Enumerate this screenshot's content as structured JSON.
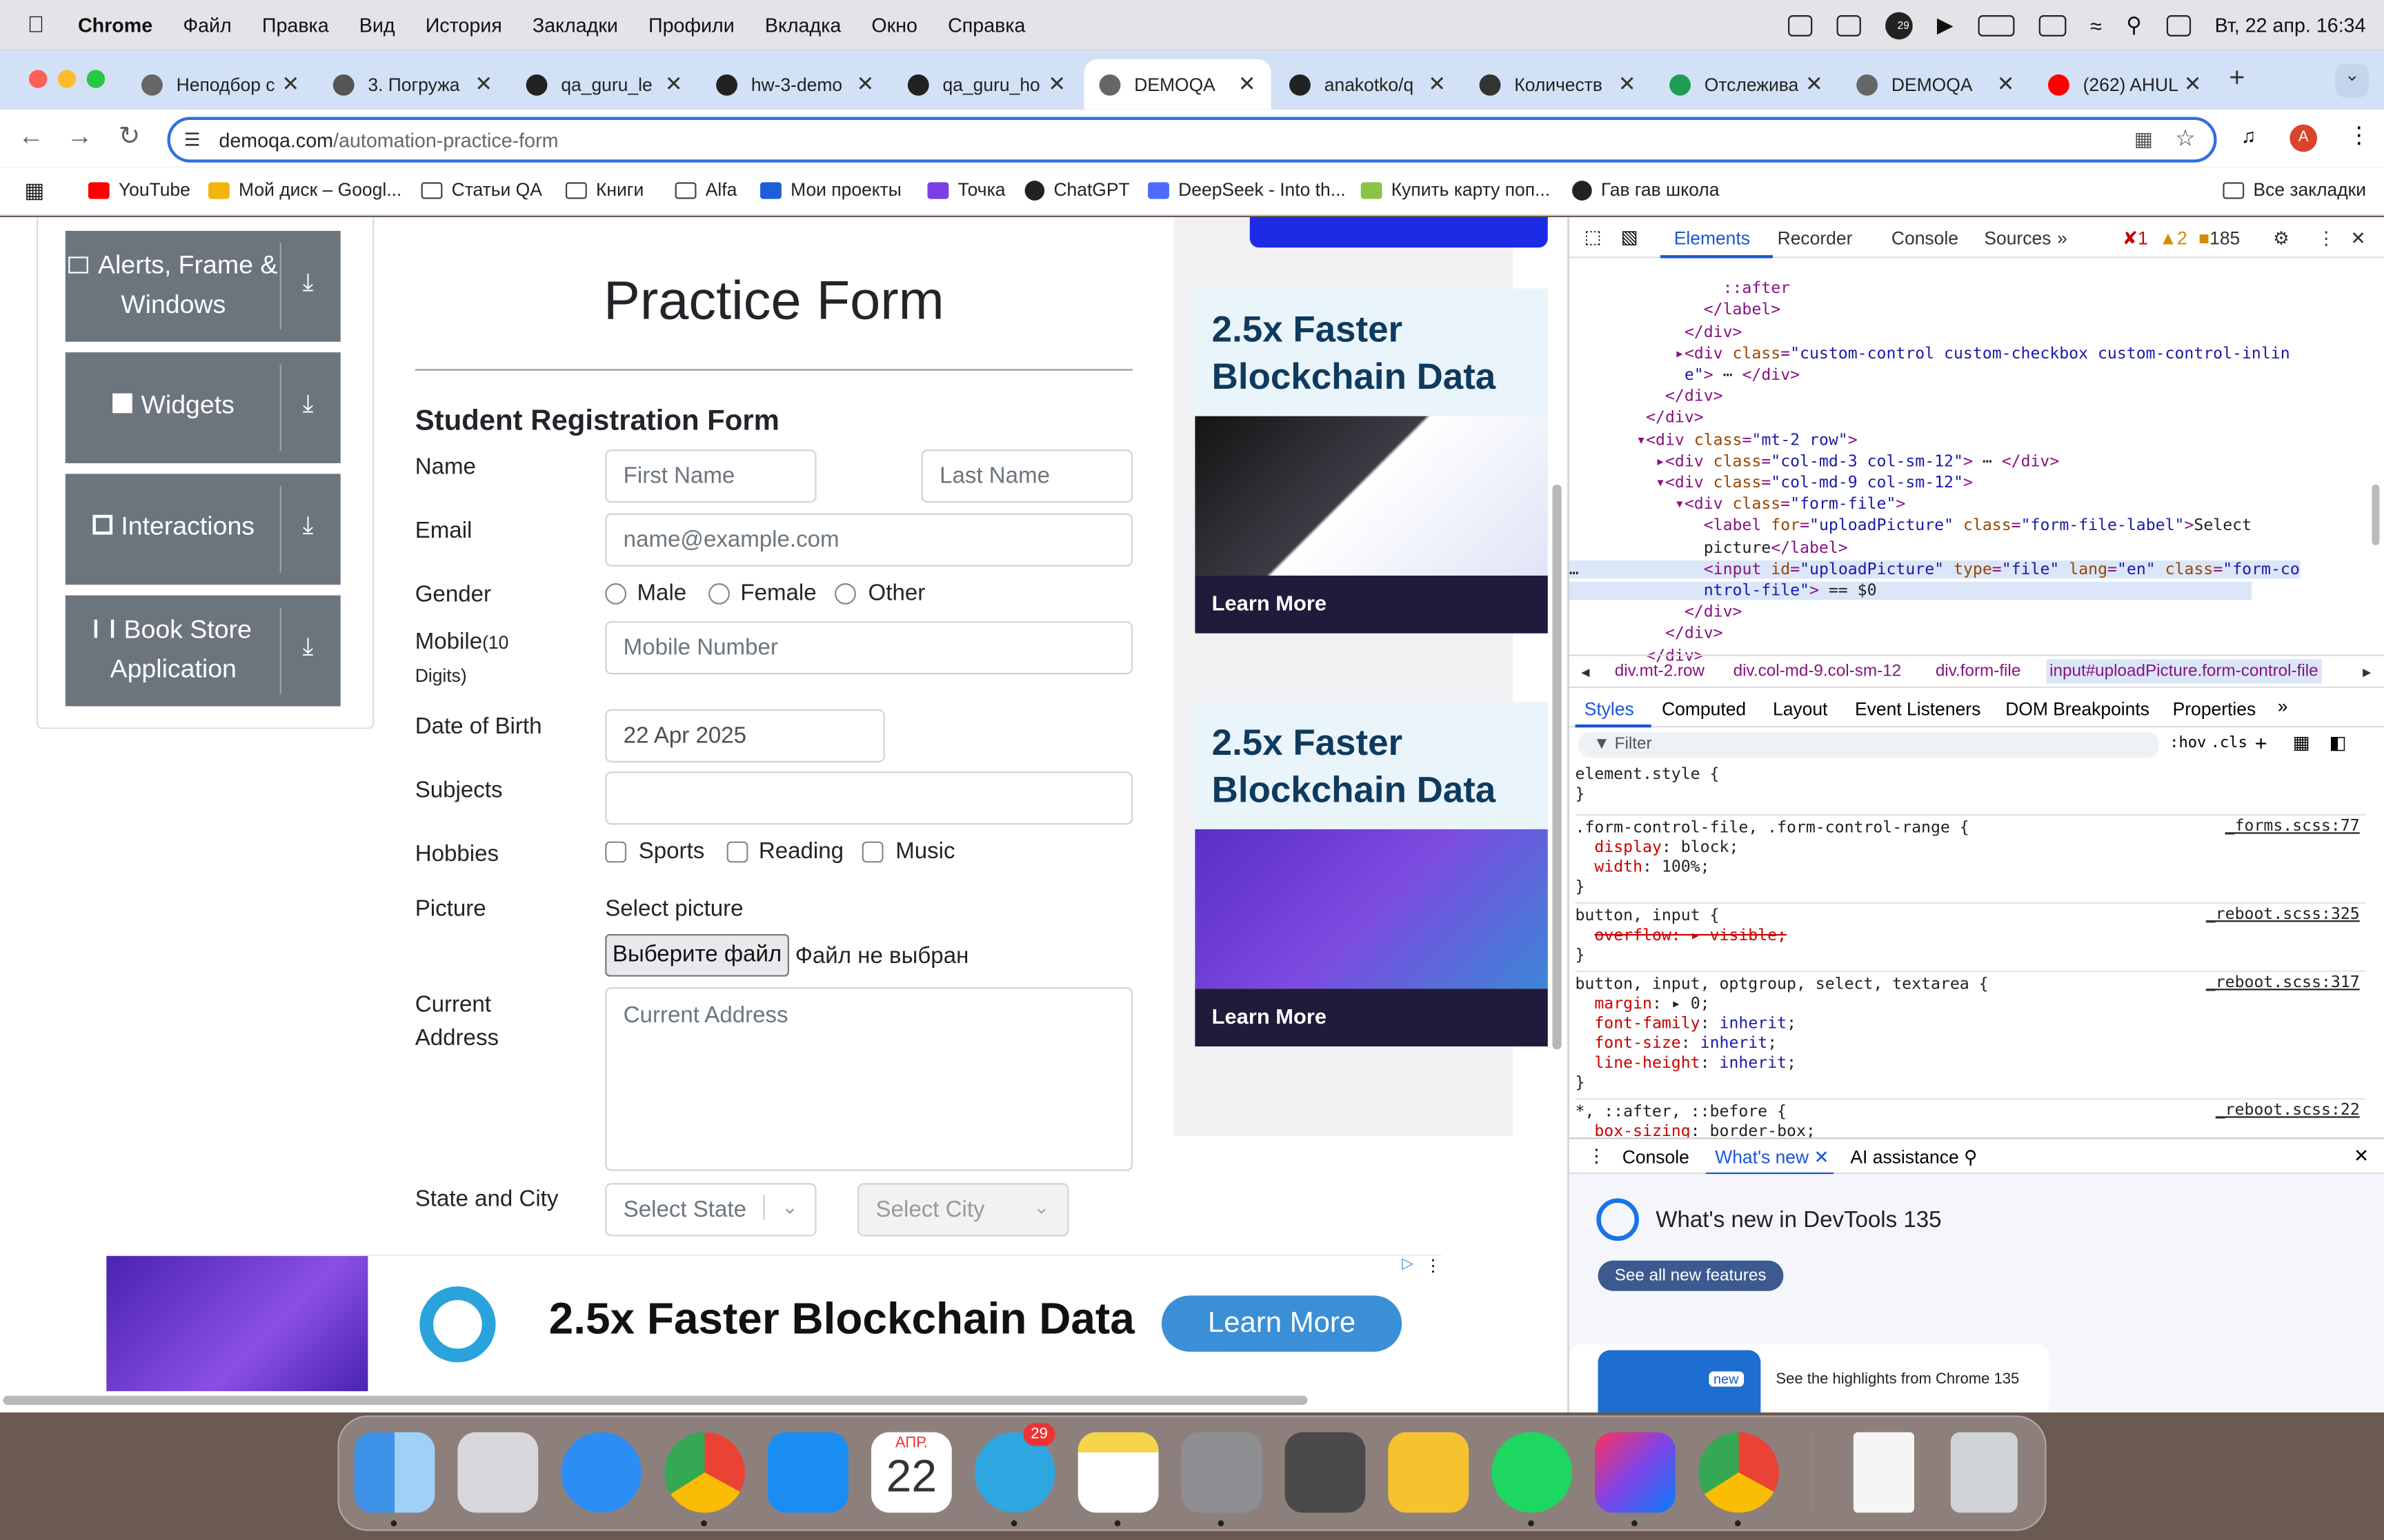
{
  "menubar": {
    "app": "Chrome",
    "items": [
      "Файл",
      "Правка",
      "Вид",
      "История",
      "Закладки",
      "Профили",
      "Вкладка",
      "Окно",
      "Справка"
    ],
    "clock": "Вт, 22 апр.  16:34",
    "badge": "29"
  },
  "tabs": [
    {
      "title": "Неподбор с"
    },
    {
      "title": "3. Погружа"
    },
    {
      "title": "qa_guru_le"
    },
    {
      "title": "hw-3-demo"
    },
    {
      "title": "qa_guru_ho"
    },
    {
      "title": "DEMOQA",
      "active": true
    },
    {
      "title": "anakotko/q"
    },
    {
      "title": "Количеств"
    },
    {
      "title": "Отслежива"
    },
    {
      "title": "DEMOQA"
    },
    {
      "title": "(262) AHUL"
    }
  ],
  "address": {
    "host": "demoqa.com",
    "path": "/automation-practice-form",
    "avatar": "A"
  },
  "bookmarks": [
    "YouTube",
    "Мой диск – Googl...",
    "Статьи QA",
    "Книги",
    "Alfa",
    "Мои проекты",
    "Точка",
    "ChatGPT",
    "DeepSeek - Into th...",
    "Купить карту поп...",
    "Гав гав школа"
  ],
  "bookmarks_all": "Все закладки",
  "sidebar": [
    {
      "label": "Alerts, Frame & Windows"
    },
    {
      "label": "Widgets"
    },
    {
      "label": "Interactions"
    },
    {
      "label": "Book Store Application"
    }
  ],
  "form": {
    "title": "Practice Form",
    "subtitle": "Student Registration Form",
    "name_label": "Name",
    "first_ph": "First Name",
    "last_ph": "Last Name",
    "email_label": "Email",
    "email_ph": "name@example.com",
    "gender_label": "Gender",
    "genders": [
      "Male",
      "Female",
      "Other"
    ],
    "mobile_label": "Mobile",
    "mobile_hint": "(10",
    "mobile_hint2": "Digits)",
    "mobile_ph": "Mobile Number",
    "dob_label": "Date of Birth",
    "dob_value": "22 Apr 2025",
    "subjects_label": "Subjects",
    "hobbies_label": "Hobbies",
    "hobbies": [
      "Sports",
      "Reading",
      "Music"
    ],
    "picture_label": "Picture",
    "select_picture": "Select picture",
    "choose_file": "Выберите файл",
    "no_file": "Файл не выбран",
    "address_label_1": "Current",
    "address_label_2": "Address",
    "address_ph": "Current Address",
    "state_city_label": "State and City",
    "state_ph": "Select State",
    "city_ph": "Select City"
  },
  "ads": {
    "headline_1": "2.5x Faster",
    "headline_2": "Blockchain Data",
    "learn": "Learn More",
    "banner_text": "2.5x Faster Blockchain Data",
    "banner_btn": "Learn More"
  },
  "devtools": {
    "tabs": [
      "Elements",
      "Recorder",
      "Console",
      "Sources"
    ],
    "errors": "1",
    "warnings": "2",
    "issues": "185",
    "breadcrumbs": [
      "div.mt-2.row",
      "div.col-md-9.col-sm-12",
      "div.form-file",
      "input#uploadPicture.form-control-file"
    ],
    "style_tabs": [
      "Styles",
      "Computed",
      "Layout",
      "Event Listeners",
      "DOM Breakpoints",
      "Properties"
    ],
    "filter_ph": "Filter",
    "hov": ":hov",
    ".cls": ".cls",
    "rules": [
      {
        "sel": "element.style {",
        "src": ""
      },
      {
        "sel": ".form-control-file, .form-control-range {",
        "src": "_forms.scss:77"
      },
      {
        "sel": "button, input {",
        "src": "_reboot.scss:325"
      },
      {
        "sel": "button, input, optgroup, select, textarea {",
        "src": "_reboot.scss:317"
      },
      {
        "sel": "*, ::after, ::before {",
        "src": "_reboot.scss:22"
      }
    ],
    "drawer_tabs": [
      "Console",
      "What's new",
      "AI assistance"
    ],
    "whatsnew_title": "What's new in DevTools 135",
    "whatsnew_btn": "See all new features",
    "new_badge": "new",
    "highlights": "See the highlights from Chrome 135"
  },
  "dock": {
    "calendar_month": "АПР.",
    "calendar_day": "22",
    "telegram_badge": "29"
  }
}
